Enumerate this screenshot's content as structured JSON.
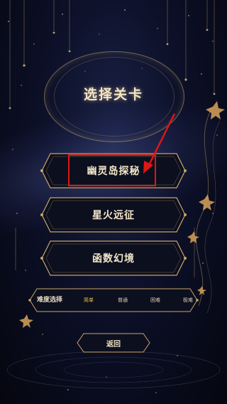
{
  "screen": {
    "title": "选择关卡"
  },
  "levels": [
    {
      "label": "幽灵岛探秘",
      "selected": true
    },
    {
      "label": "星火远征",
      "selected": false
    },
    {
      "label": "函数幻境",
      "selected": false
    }
  ],
  "difficulty": {
    "label": "难度选择",
    "options": [
      "简单",
      "普通",
      "困难",
      "极难"
    ],
    "selected": "简单"
  },
  "back": {
    "label": "返回"
  },
  "colors": {
    "gold": "#c9a56a",
    "text": "#f2e6c8",
    "active": "#f5c343",
    "highlight": "#e01616",
    "background": "#0c1028"
  },
  "icons": [
    "star-icon",
    "leaf-icon",
    "arrow-pointer-icon"
  ]
}
